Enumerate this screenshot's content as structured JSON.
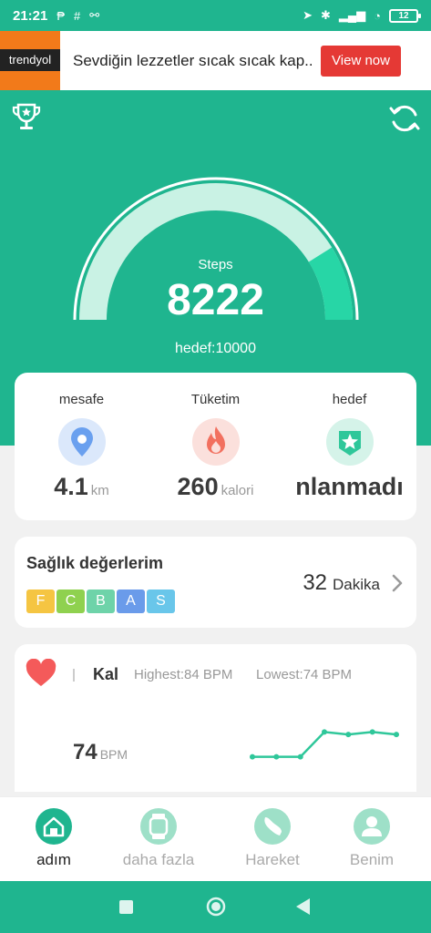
{
  "status_bar": {
    "time": "21:21",
    "left_icons": [
      "p-icon",
      "grid-icon",
      "link-icon"
    ],
    "battery": "12"
  },
  "ad": {
    "brand": "trendyol",
    "text": "Sevdiğin lezzetler sıcak sıcak kap...",
    "button": "View now"
  },
  "hero": {
    "steps_label": "Steps",
    "steps_value": "8222",
    "goal_text": "hedef:10000",
    "progress": 0.8222
  },
  "stats": {
    "distance": {
      "label": "mesafe",
      "value": "4.1",
      "unit": "km"
    },
    "calories": {
      "label": "Tüketim",
      "value": "260",
      "unit": "kalori"
    },
    "goal": {
      "label": "hedef",
      "value": "nlanmadı"
    }
  },
  "health": {
    "title": "Sağlık değerlerim",
    "grades": [
      {
        "letter": "F",
        "color": "#f5c542"
      },
      {
        "letter": "C",
        "color": "#8fd14f"
      },
      {
        "letter": "B",
        "color": "#6ed3a9"
      },
      {
        "letter": "A",
        "color": "#6a9bea"
      },
      {
        "letter": "S",
        "color": "#69c6ea"
      }
    ],
    "minutes": "32",
    "minutes_unit": "Dakika"
  },
  "heart_rate": {
    "title": "Kal",
    "highest": "Highest:84  BPM",
    "lowest": "Lowest:74  BPM",
    "current": "74",
    "unit": "BPM",
    "series": [
      74,
      74,
      74,
      84,
      83,
      84,
      83
    ]
  },
  "nav": {
    "items": [
      {
        "label": "adım",
        "icon": "home-icon"
      },
      {
        "label": "daha fazla",
        "icon": "watch-icon"
      },
      {
        "label": "Hareket",
        "icon": "shoe-icon"
      },
      {
        "label": "Benim",
        "icon": "user-icon"
      }
    ]
  },
  "colors": {
    "brand": "#1fb58f",
    "gauge_track": "#c9f2e4",
    "gauge_fill": "#27d6a6",
    "ad_button": "#e53935"
  }
}
